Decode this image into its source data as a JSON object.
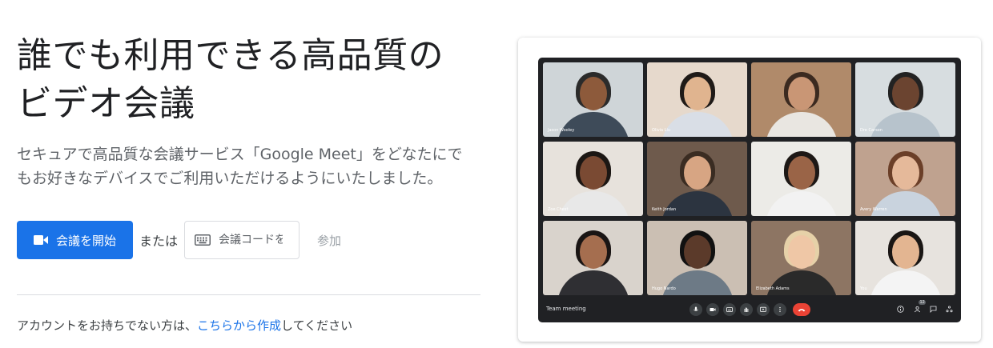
{
  "hero": {
    "headline_line1": "誰でも利用できる高品質の",
    "headline_line2": "ビデオ会議",
    "subtitle_line1": "セキュアで高品質な会議サービス「Google Meet」をどなたにで",
    "subtitle_line2": "もお好きなデバイスでご利用いただけるようにいたしました。"
  },
  "actions": {
    "start_label": "会議を開始",
    "or_label": "または",
    "code_placeholder": "会議コードを",
    "join_label": "参加"
  },
  "signup": {
    "prefix": "アカウントをお持ちでない方は、",
    "link": "こちらから作成",
    "suffix": "してください"
  },
  "meeting": {
    "title": "Team meeting",
    "participant_names": [
      "Jason Wooley",
      "Olivia Liu",
      "",
      "Dre Carson",
      "Zoe Chest",
      "Keith Jordan",
      "",
      "Avery Warren",
      "",
      "Hugo Nardo",
      "Elizabeth Adams",
      "You"
    ],
    "people_count": "12"
  },
  "colors": {
    "primary": "#1a73e8",
    "text": "#202124",
    "secondary_text": "#5f6368",
    "meet_bg": "#202124",
    "hangup": "#ea4335"
  }
}
